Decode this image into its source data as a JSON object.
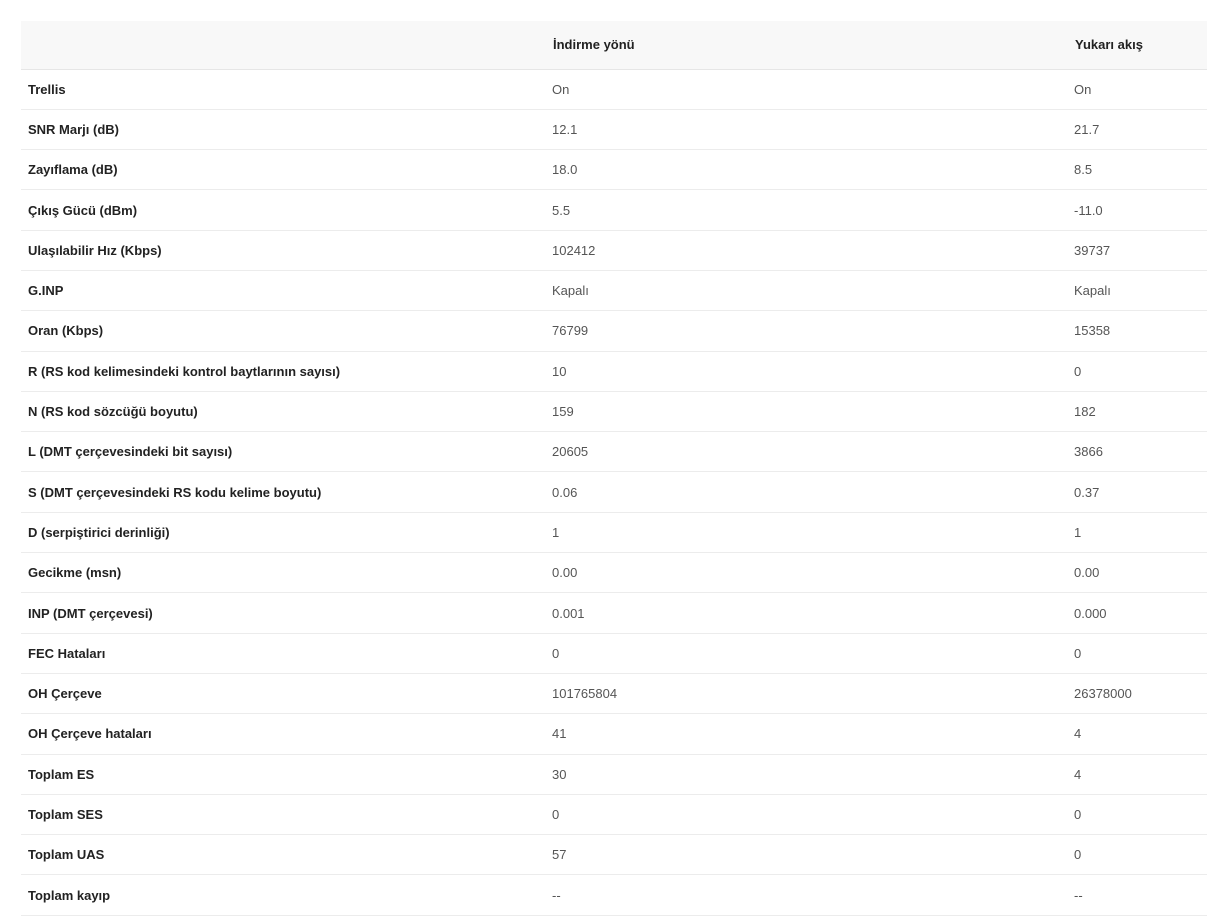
{
  "table": {
    "headers": [
      "",
      "İndirme yönü",
      "Yukarı akış"
    ],
    "rows": [
      {
        "label": "Trellis",
        "downstream": "On",
        "upstream": "On"
      },
      {
        "label": "SNR Marjı (dB)",
        "downstream": "12.1",
        "upstream": "21.7"
      },
      {
        "label": "Zayıflama (dB)",
        "downstream": "18.0",
        "upstream": "8.5"
      },
      {
        "label": "Çıkış Gücü (dBm)",
        "downstream": "5.5",
        "upstream": "-11.0"
      },
      {
        "label": "Ulaşılabilir Hız (Kbps)",
        "downstream": "102412",
        "upstream": "39737"
      },
      {
        "label": "G.INP",
        "downstream": "Kapalı",
        "upstream": "Kapalı"
      },
      {
        "label": "Oran (Kbps)",
        "downstream": "76799",
        "upstream": "15358"
      },
      {
        "label": "R (RS kod kelimesindeki kontrol baytlarının sayısı)",
        "downstream": "10",
        "upstream": "0"
      },
      {
        "label": "N (RS kod sözcüğü boyutu)",
        "downstream": "159",
        "upstream": "182"
      },
      {
        "label": "L (DMT çerçevesindeki bit sayısı)",
        "downstream": "20605",
        "upstream": "3866"
      },
      {
        "label": "S (DMT çerçevesindeki RS kodu kelime boyutu)",
        "downstream": "0.06",
        "upstream": "0.37"
      },
      {
        "label": "D (serpiştirici derinliği)",
        "downstream": "1",
        "upstream": "1"
      },
      {
        "label": "Gecikme (msn)",
        "downstream": "0.00",
        "upstream": "0.00"
      },
      {
        "label": "INP (DMT çerçevesi)",
        "downstream": "0.001",
        "upstream": "0.000"
      },
      {
        "label": "FEC Hataları",
        "downstream": "0",
        "upstream": "0"
      },
      {
        "label": "OH Çerçeve",
        "downstream": "101765804",
        "upstream": "26378000"
      },
      {
        "label": "OH Çerçeve hataları",
        "downstream": "41",
        "upstream": "4"
      },
      {
        "label": "Toplam ES",
        "downstream": "30",
        "upstream": "4"
      },
      {
        "label": "Toplam SES",
        "downstream": "0",
        "upstream": "0"
      },
      {
        "label": "Toplam UAS",
        "downstream": "57",
        "upstream": "0"
      },
      {
        "label": "Toplam kayıp",
        "downstream": "--",
        "upstream": "--"
      }
    ]
  },
  "colors": {
    "header_bg": "#f8f8f8",
    "row_border": "#ececec",
    "label_text": "#222222",
    "value_text": "#555555"
  }
}
